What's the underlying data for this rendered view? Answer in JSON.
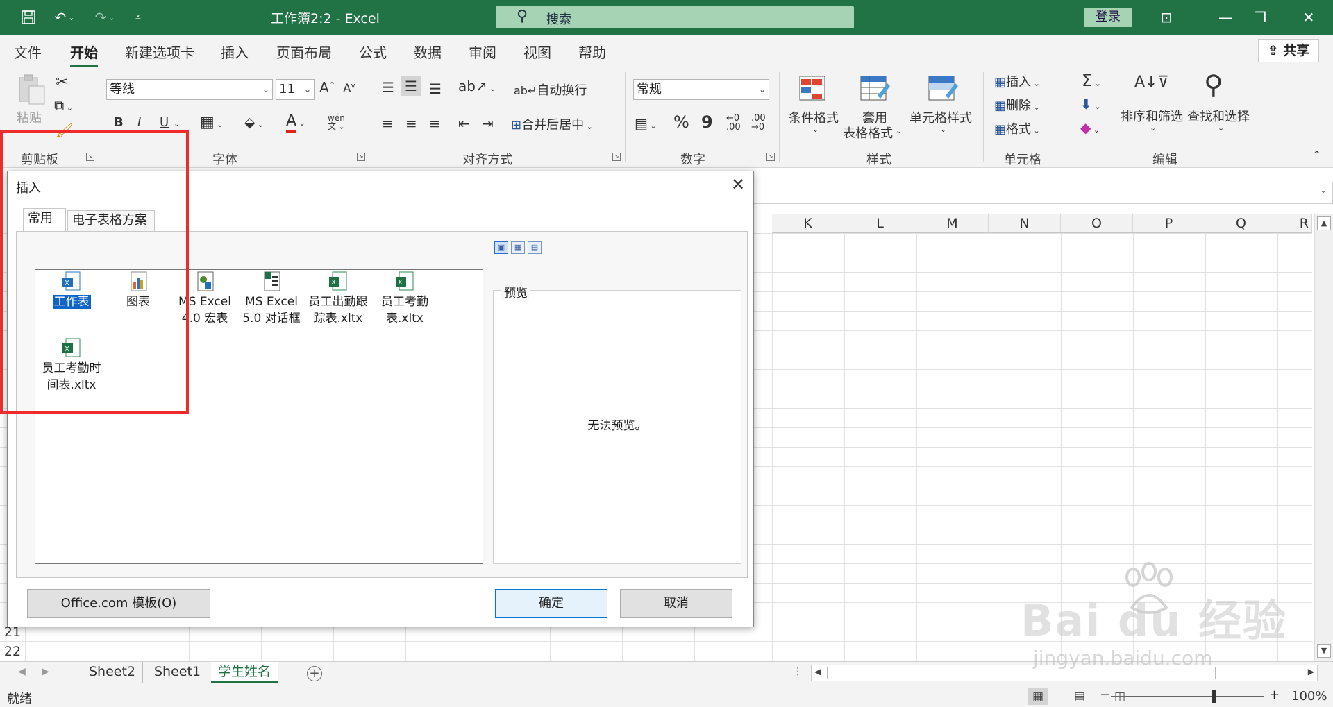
{
  "titlebar": {
    "title": "工作簿2:2  -  Excel",
    "search_placeholder": "搜索",
    "login": "登录"
  },
  "ribbon_tabs": [
    "文件",
    "开始",
    "新建选项卡",
    "插入",
    "页面布局",
    "公式",
    "数据",
    "审阅",
    "视图",
    "帮助"
  ],
  "active_tab": "开始",
  "share": "共享",
  "ribbon": {
    "clipboard": {
      "paste": "粘贴",
      "label": "剪贴板"
    },
    "font": {
      "name": "等线",
      "size": "11",
      "label": "字体",
      "bold": "B",
      "italic": "I",
      "underline": "U"
    },
    "alignment": {
      "wrap": "自动换行",
      "merge": "合并后居中",
      "label": "对齐方式"
    },
    "number": {
      "format": "常规",
      "percent": "%",
      "comma": "9",
      "label": "数字"
    },
    "styles": {
      "conditional": "条件格式",
      "table_format_1": "套用",
      "table_format_2": "表格格式",
      "cell_styles": "单元格样式",
      "label": "样式"
    },
    "cells": {
      "insert": "插入",
      "delete": "删除",
      "format": "格式",
      "label": "单元格"
    },
    "editing": {
      "sort_filter": "排序和筛选",
      "find_select": "查找和选择",
      "label": "编辑"
    }
  },
  "grid": {
    "columns": [
      "K",
      "L",
      "M",
      "N",
      "O",
      "P",
      "Q",
      "R"
    ],
    "visible_rows": [
      "21",
      "22"
    ]
  },
  "sheets": [
    {
      "name": "Sheet2",
      "active": false
    },
    {
      "name": "Sheet1",
      "active": false
    },
    {
      "name": "学生姓名",
      "active": true
    }
  ],
  "status": {
    "ready": "就绪",
    "zoom": "100%"
  },
  "dialog": {
    "title": "插入",
    "tabs": [
      "常用",
      "电子表格方案"
    ],
    "active_tab": "常用",
    "items": [
      {
        "label_1": "工作表",
        "label_2": "",
        "icon": "excel-worksheet-icon",
        "selected": true
      },
      {
        "label_1": "图表",
        "label_2": "",
        "icon": "chart-icon",
        "selected": false
      },
      {
        "label_1": "MS Excel",
        "label_2": "4.0 宏表",
        "icon": "macro-sheet-icon",
        "selected": false
      },
      {
        "label_1": "MS Excel",
        "label_2": "5.0 对话框",
        "icon": "dialog-sheet-icon",
        "selected": false
      },
      {
        "label_1": "员工出勤跟",
        "label_2": "踪表.xltx",
        "icon": "excel-template-icon",
        "selected": false
      },
      {
        "label_1": "员工考勤",
        "label_2": "表.xltx",
        "icon": "excel-template-icon",
        "selected": false
      },
      {
        "label_1": "员工考勤时",
        "label_2": "间表.xltx",
        "icon": "excel-template-icon",
        "selected": false
      }
    ],
    "preview_label": "预览",
    "no_preview": "无法预览。",
    "office_templates": "Office.com 模板(O)",
    "ok": "确定",
    "cancel": "取消"
  },
  "watermark": {
    "brand": "Bai du 经验",
    "url": "jingyan.baidu.com"
  },
  "colors": {
    "excel_green": "#217346",
    "highlight_red": "#ef2b2b",
    "selection_blue": "#1064c8"
  }
}
